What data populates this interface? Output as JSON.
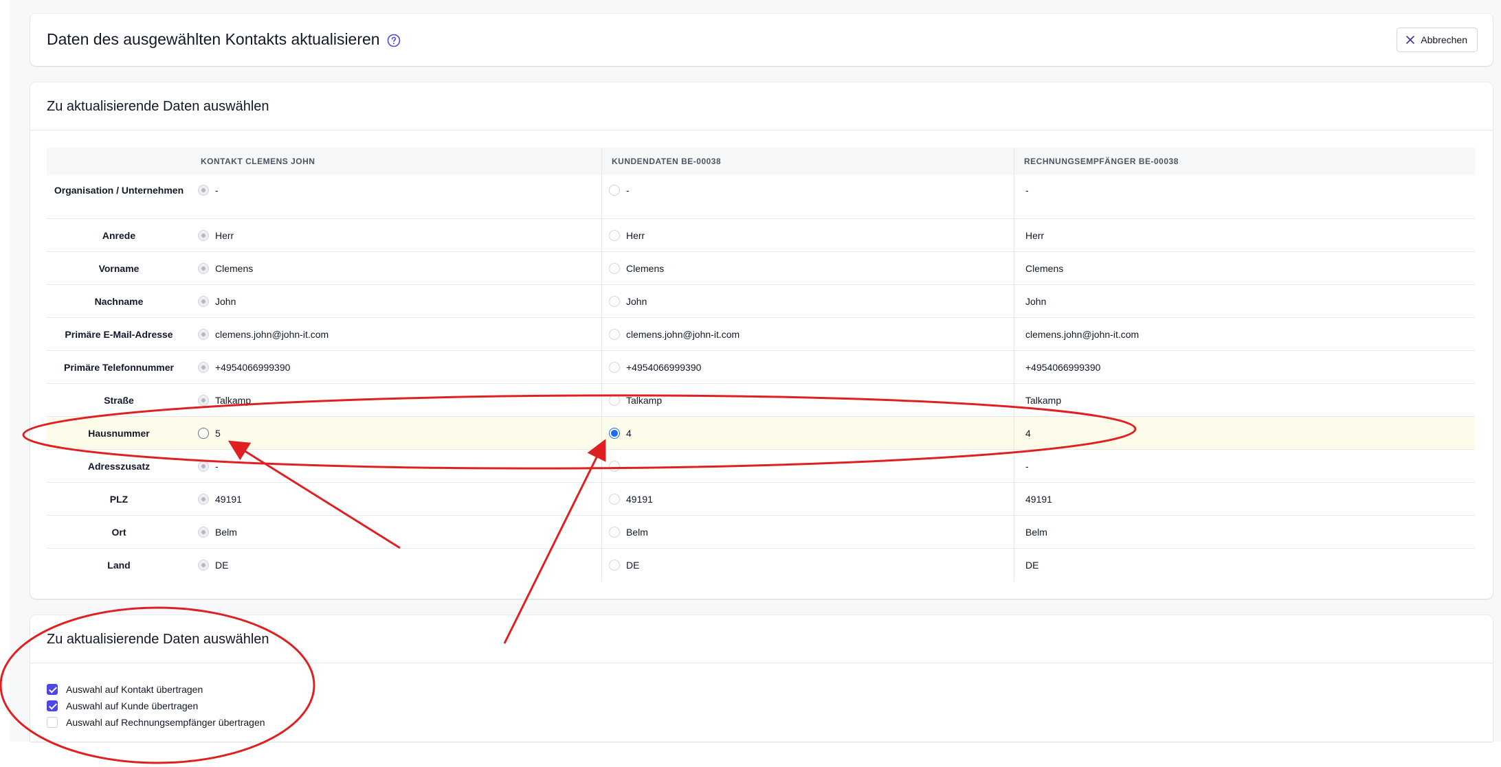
{
  "header": {
    "title": "Daten des ausgewählten Kontakts aktualisieren",
    "help_icon": "question-circle-icon",
    "cancel_label": "Abbrechen",
    "cancel_icon": "close-icon"
  },
  "compare": {
    "section_title": "Zu aktualisierende Daten auswählen",
    "columns": [
      "",
      "KONTAKT CLEMENS JOHN",
      "KUNDENDATEN BE-00038",
      "RECHNUNGSEMPFÄNGER BE-00038"
    ],
    "rows": [
      {
        "label": "Organisation / Unternehmen",
        "contact": "-",
        "customer": "-",
        "invoice": "-"
      },
      {
        "label": "Anrede",
        "contact": "Herr",
        "customer": "Herr",
        "invoice": "Herr"
      },
      {
        "label": "Vorname",
        "contact": "Clemens",
        "customer": "Clemens",
        "invoice": "Clemens"
      },
      {
        "label": "Nachname",
        "contact": "John",
        "customer": "John",
        "invoice": "John"
      },
      {
        "label": "Primäre E-Mail-Adresse",
        "contact": "clemens.john@john-it.com",
        "customer": "clemens.john@john-it.com",
        "invoice": "clemens.john@john-it.com"
      },
      {
        "label": "Primäre Telefonnummer",
        "contact": "+4954066999390",
        "customer": "+4954066999390",
        "invoice": "+4954066999390"
      },
      {
        "label": "Straße",
        "contact": "Talkamp",
        "customer": "Talkamp",
        "invoice": "Talkamp"
      },
      {
        "label": "Hausnummer",
        "contact": "5",
        "customer": "4",
        "invoice": "4"
      },
      {
        "label": "Adresszusatz",
        "contact": "-",
        "customer": "-",
        "invoice": "-"
      },
      {
        "label": "PLZ",
        "contact": "49191",
        "customer": "49191",
        "invoice": "49191"
      },
      {
        "label": "Ort",
        "contact": "Belm",
        "customer": "Belm",
        "invoice": "Belm"
      },
      {
        "label": "Land",
        "contact": "DE",
        "customer": "DE",
        "invoice": "DE"
      }
    ]
  },
  "transfer": {
    "section_title": "Zu aktualisierende Daten auswählen",
    "options": [
      {
        "label": "Auswahl auf Kontakt übertragen",
        "checked": true
      },
      {
        "label": "Auswahl auf Kunde übertragen",
        "checked": true
      },
      {
        "label": "Auswahl auf Rechnungsempfänger übertragen",
        "checked": false
      }
    ]
  },
  "annotations": {
    "color": "#e02020"
  },
  "colors": {
    "accent": "#4f46e5",
    "radio_selected": "#1769ff",
    "highlight_row": "#fdfbea"
  }
}
